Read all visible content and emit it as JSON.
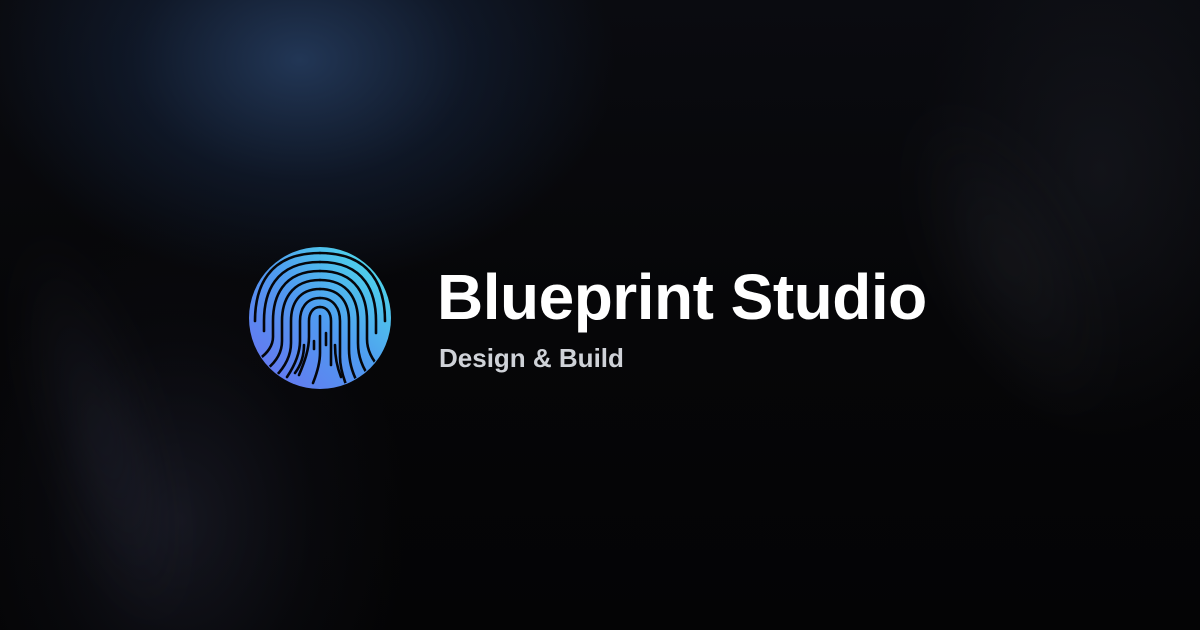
{
  "brand": {
    "name": "Blueprint Studio",
    "tagline": "Design & Build",
    "logo_icon": "fingerprint-icon"
  },
  "colors": {
    "background": "#050506",
    "glow": "#263e62",
    "logo_gradient_start": "#6a6ff0",
    "logo_gradient_mid": "#4f9bf0",
    "logo_gradient_end": "#4ee6e8",
    "title": "#ffffff",
    "tagline": "#cfd2d8"
  }
}
